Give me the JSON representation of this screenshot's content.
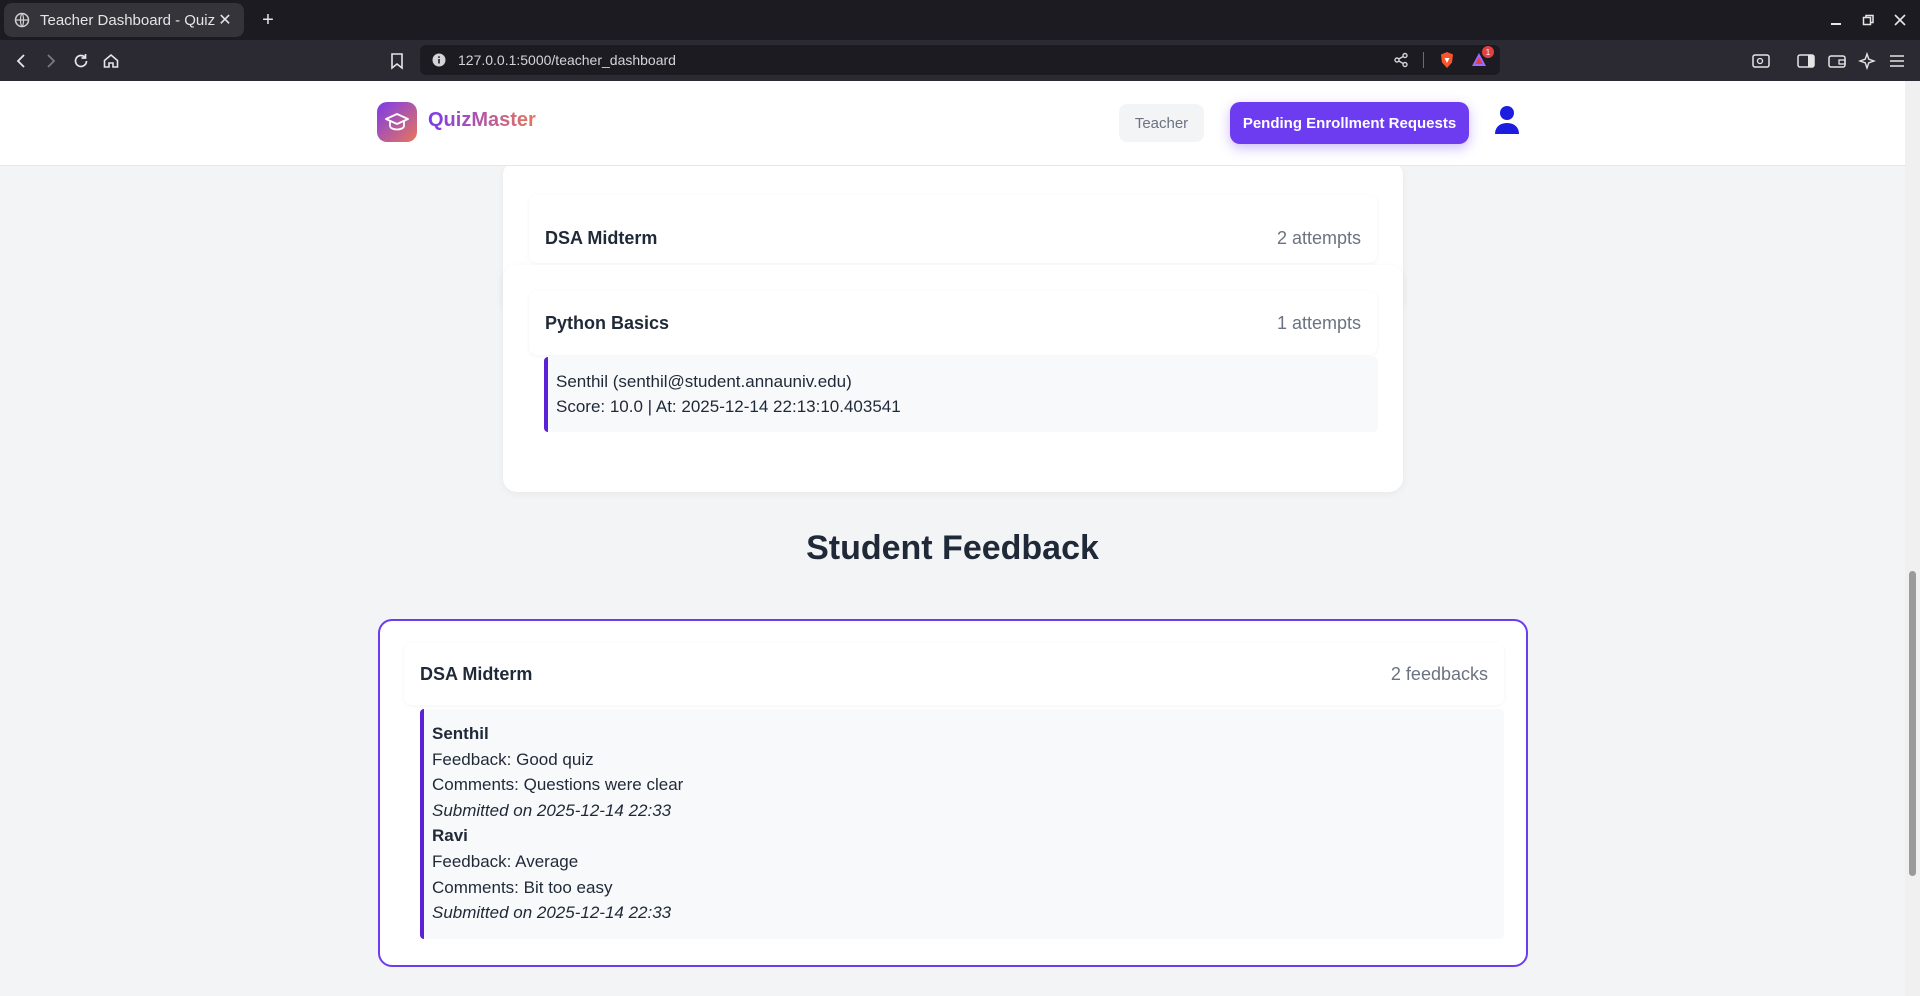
{
  "browser": {
    "tab_title": "Teacher Dashboard - Quiz",
    "url": "127.0.0.1:5000/teacher_dashboard",
    "notification_count": "1"
  },
  "header": {
    "brand": "QuizMaster",
    "role": "Teacher",
    "pending_button": "Pending Enrollment Requests"
  },
  "attempts": {
    "quizzes": [
      {
        "title": "DSA Midterm",
        "count": "2 attempts"
      },
      {
        "title": "Python Basics",
        "count": "1 attempts",
        "entries": [
          {
            "student": "Senthil (senthil@student.annauniv.edu)",
            "detail": "Score: 10.0 | At: 2025-12-14 22:13:10.403541"
          }
        ]
      }
    ]
  },
  "feedback": {
    "section_title": "Student Feedback",
    "quiz_title": "DSA Midterm",
    "count": "2 feedbacks",
    "items": [
      {
        "name": "Senthil",
        "feedback": "Feedback: Good quiz",
        "comments": "Comments: Questions were clear",
        "submitted": "Submitted on 2025-12-14 22:33"
      },
      {
        "name": "Ravi",
        "feedback": "Feedback: Average",
        "comments": "Comments: Bit too easy",
        "submitted": "Submitted on 2025-12-14 22:33"
      }
    ]
  },
  "colors": {
    "accent": "#6d3cf0",
    "accent_border": "#5b21d6"
  }
}
